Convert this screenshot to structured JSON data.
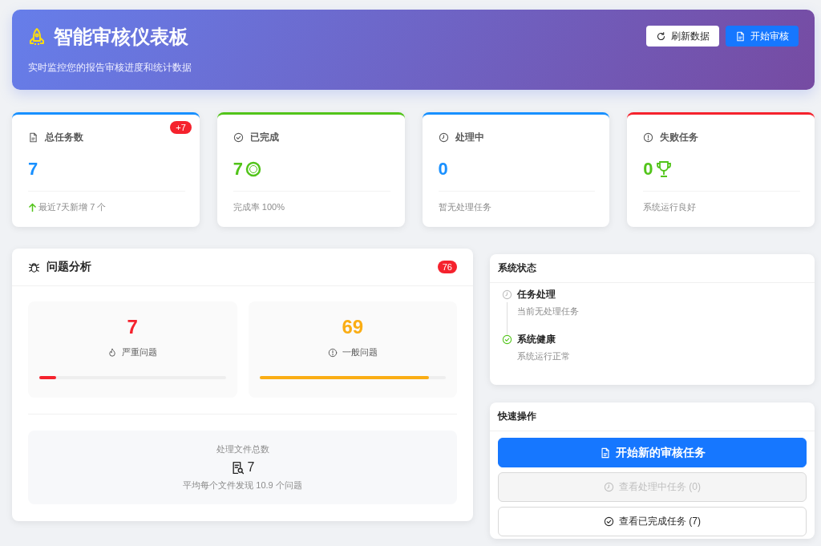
{
  "header": {
    "title": "智能审核仪表板",
    "subtitle": "实时监控您的报告审核进度和统计数据",
    "buttons": [
      {
        "label": "刷新数据",
        "kind": "refresh",
        "primary": false
      },
      {
        "label": "开始审核",
        "kind": "file",
        "primary": true
      }
    ]
  },
  "stats": [
    {
      "title": "总任务数",
      "value": "7",
      "badge": "+7",
      "footer": "最近7天新增 7 个",
      "trend_up": true
    },
    {
      "title": "已完成",
      "value": "7",
      "footer": "完成率 100%",
      "trend_up": false
    },
    {
      "title": "处理中",
      "value": "0",
      "footer": "暂无处理任务",
      "trend_up": false
    },
    {
      "title": "失败任务",
      "value": "0",
      "footer": "系统运行良好",
      "trend_up": false
    }
  ],
  "issues": {
    "title": "问题分析",
    "badge": "76",
    "items": [
      {
        "value": "7",
        "label": "严重问题",
        "color": "#f5222d",
        "level": 0.09
      },
      {
        "value": "69",
        "label": "一般问题",
        "color": "#faad14",
        "level": 0.91
      }
    ],
    "files": {
      "label": "处理文件总数",
      "value": "7",
      "summary": "平均每个文件发现 10.9 个问题"
    }
  },
  "system_status": {
    "title": "系统状态",
    "items": [
      {
        "title": "任务处理",
        "detail": "当前无处理任务",
        "kind": "pending"
      },
      {
        "title": "系统健康",
        "detail": "系统运行正常",
        "kind": "success"
      }
    ]
  },
  "quick_actions": {
    "title": "快速操作",
    "buttons": [
      {
        "label": "开始新的审核任务",
        "primary": true,
        "disabled": false
      },
      {
        "label": "查看处理中任务 (0)",
        "primary": false,
        "disabled": true
      },
      {
        "label": "查看已完成任务 (7)",
        "primary": false,
        "disabled": false
      }
    ]
  }
}
